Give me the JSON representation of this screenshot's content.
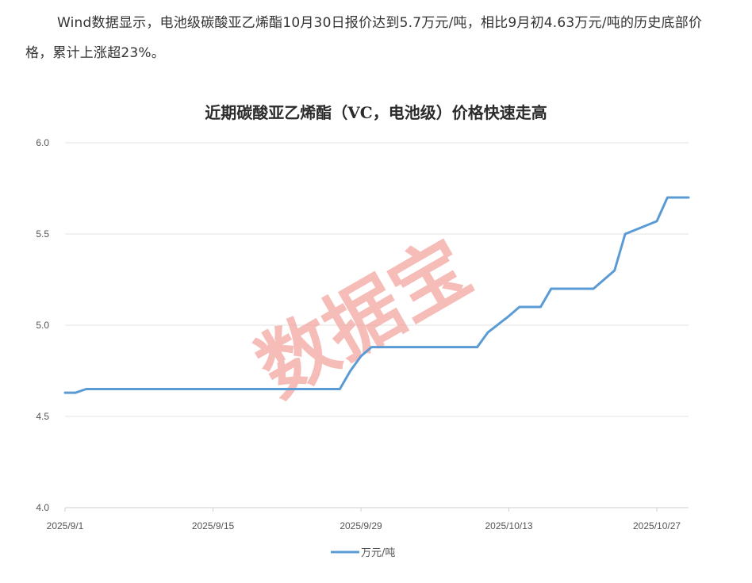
{
  "article": {
    "text": "Wind数据显示，电池级碳酸亚乙烯酯10月30日报价达到5.7万元/吨，相比9月初4.63万元/吨的历史底部价格，累计上涨超23%。"
  },
  "watermark": "数据宝",
  "colors": {
    "line": "#5b9bd5",
    "grid": "#e3e3e3",
    "watermark": "#f3a6a0"
  },
  "chart_data": {
    "type": "line",
    "title": "近期碳酸亚乙烯酯（VC，电池级）价格快速走高",
    "xlabel": "",
    "ylabel": "",
    "ylim": [
      4.0,
      6.0
    ],
    "y_ticks": [
      "4.0",
      "4.5",
      "5.0",
      "5.5",
      "6.0"
    ],
    "x_ticks": [
      {
        "label": "2025/9/1",
        "day": 0
      },
      {
        "label": "2025/9/15",
        "day": 14
      },
      {
        "label": "2025/9/29",
        "day": 28
      },
      {
        "label": "2025/10/13",
        "day": 42
      },
      {
        "label": "2025/10/27",
        "day": 56
      }
    ],
    "grid": true,
    "legend": "bottom",
    "series": [
      {
        "name": "万元/吨",
        "points": [
          [
            0,
            4.63
          ],
          [
            1,
            4.63
          ],
          [
            2,
            4.65
          ],
          [
            25,
            4.65
          ],
          [
            26,
            4.65
          ],
          [
            27,
            4.75
          ],
          [
            28,
            4.83
          ],
          [
            29,
            4.88
          ],
          [
            39,
            4.88
          ],
          [
            40,
            4.96
          ],
          [
            42,
            5.05
          ],
          [
            43,
            5.1
          ],
          [
            45,
            5.1
          ],
          [
            46,
            5.2
          ],
          [
            50,
            5.2
          ],
          [
            52,
            5.3
          ],
          [
            53,
            5.5
          ],
          [
            56,
            5.57
          ],
          [
            57,
            5.7
          ],
          [
            59,
            5.7
          ]
        ]
      }
    ]
  }
}
